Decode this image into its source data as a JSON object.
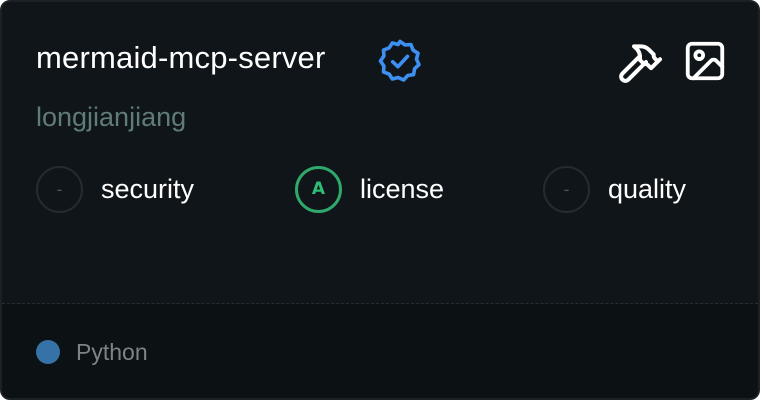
{
  "card": {
    "title": "mermaid-mcp-server",
    "author": "longjianjiang",
    "verified_icon": "verified-badge-icon",
    "tools_icon": "hammer-icon",
    "image_icon": "image-icon",
    "metrics": [
      {
        "badge": "-",
        "label": "security"
      },
      {
        "badge": "A",
        "label": "license"
      },
      {
        "badge": "-",
        "label": "quality"
      }
    ],
    "language": {
      "name": "Python",
      "color": "#3572a5"
    }
  }
}
